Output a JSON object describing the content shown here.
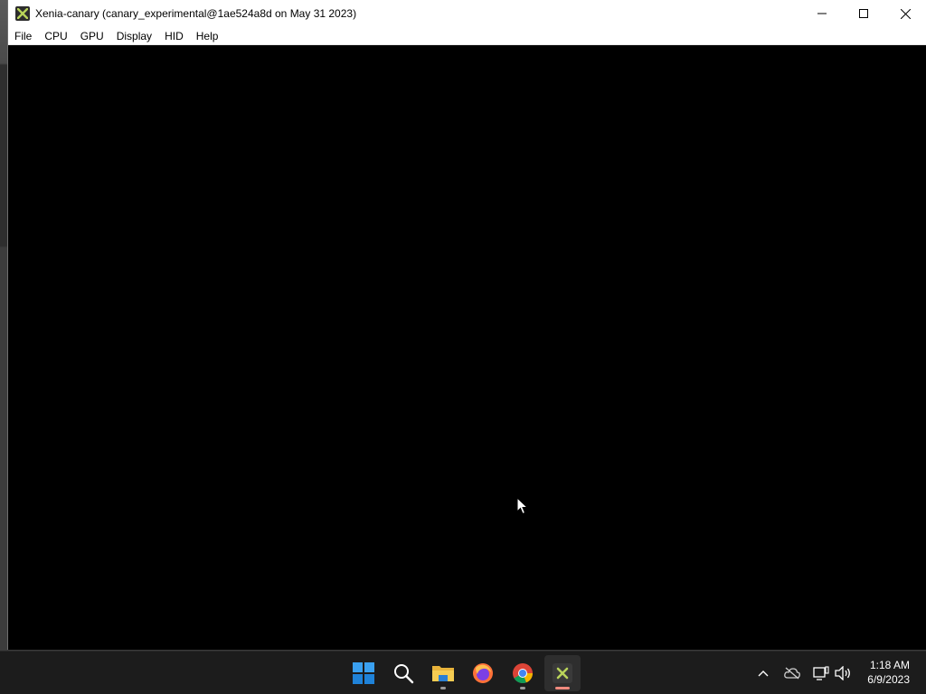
{
  "window": {
    "title": "Xenia-canary (canary_experimental@1ae524a8d on May 31 2023)",
    "icon": "xenia-icon",
    "controls": [
      "minimize-icon",
      "maximize-icon",
      "close-icon"
    ]
  },
  "menu": {
    "items": [
      {
        "label": "File"
      },
      {
        "label": "CPU"
      },
      {
        "label": "GPU"
      },
      {
        "label": "Display"
      },
      {
        "label": "HID"
      },
      {
        "label": "Help"
      }
    ]
  },
  "taskbar": {
    "apps": [
      {
        "name": "start-button",
        "icon": "windows-logo-icon"
      },
      {
        "name": "search-button",
        "icon": "search-icon"
      },
      {
        "name": "file-explorer-button",
        "icon": "folder-icon",
        "running": true
      },
      {
        "name": "firefox-button",
        "icon": "firefox-icon"
      },
      {
        "name": "chrome-button",
        "icon": "chrome-icon",
        "running": true
      },
      {
        "name": "xenia-taskbar-button",
        "icon": "xenia-icon",
        "active": true
      }
    ],
    "tray": [
      "chevron-up-icon",
      "onedrive-icon",
      "network-icon",
      "volume-icon"
    ],
    "clock": {
      "time": "1:18 AM",
      "date": "6/9/2023"
    }
  },
  "colors": {
    "taskbar_bg": "#1c1c1c",
    "titlebar_bg": "#ffffff",
    "render_bg": "#000000",
    "active_indicator": "#f08a7e",
    "running_indicator": "#9a9a9a"
  }
}
